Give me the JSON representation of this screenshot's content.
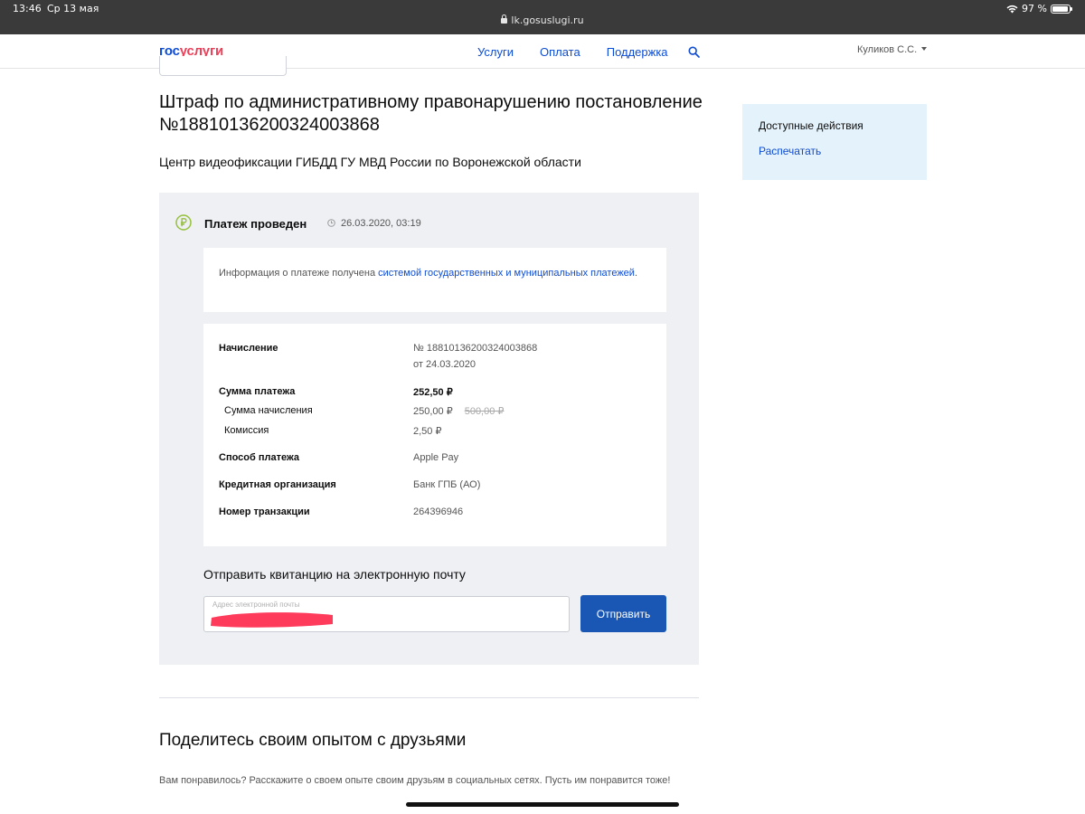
{
  "status_bar": {
    "time": "13:46",
    "date": "Ср 13 мая",
    "url": "lk.gosuslugi.ru",
    "battery": "97 %",
    "battery_level": 0.97
  },
  "header": {
    "logo_part1": "гос",
    "logo_part2": "услуги",
    "nav": [
      "Услуги",
      "Оплата",
      "Поддержка"
    ],
    "user": "Куликов С.С."
  },
  "page": {
    "title": "Штраф по административному правонарушению постановление №18810136200324003868",
    "subtitle": "Центр видеофиксации ГИБДД ГУ МВД России по Воронежской области"
  },
  "sidebar": {
    "heading": "Доступные действия",
    "print_link": "Распечатать"
  },
  "payment": {
    "status": "Платеж проведен",
    "datetime": "26.03.2020, 03:19",
    "info_text": "Информация о платеже получена ",
    "info_link": "системой государственных и муниципальных платежей",
    "info_end": ".",
    "details": {
      "charge_label": "Начисление",
      "charge_number": "№ 18810136200324003868",
      "charge_date": "от 24.03.2020",
      "total_label": "Сумма платежа",
      "total_value": "252,50 ₽",
      "charge_amount_label": "Сумма начисления",
      "charge_amount_value": "250,00 ₽",
      "charge_amount_old": "500,00 ₽",
      "fee_label": "Комиссия",
      "fee_value": "2,50 ₽",
      "method_label": "Способ платежа",
      "method_value": "Apple Pay",
      "bank_label": "Кредитная организация",
      "bank_value": "Банк ГПБ (АО)",
      "txn_label": "Номер транзакции",
      "txn_value": "264396946"
    },
    "email_title": "Отправить квитанцию на электронную почту",
    "email_placeholder": "Адрес электронной почты",
    "send_button": "Отправить"
  },
  "share": {
    "title": "Поделитесь своим опытом с друзьями",
    "text": "Вам понравилось? Расскажите о своем опыте своим друзьям в социальных сетях. Пусть им понравится тоже!"
  },
  "colors": {
    "brand_blue": "#0d4cd3",
    "brand_red": "#ee3f58",
    "success_green": "#97c03c",
    "card_bg": "#eef0f4",
    "sidebar_bg": "#e4f2fb",
    "redaction": "#ff3b5c"
  }
}
